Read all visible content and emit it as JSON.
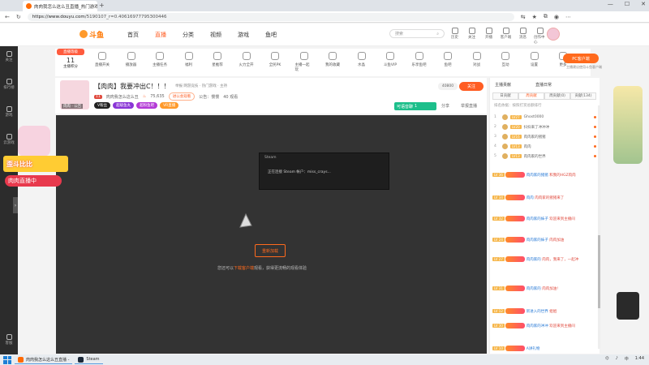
{
  "browser": {
    "tab_title": "肉肉我怎么这么丑直播_热门游戏直",
    "url_domain": "https://www.douyu.com",
    "url_path": "/5190107_r=0.40616977795300446"
  },
  "site": {
    "logo": "斗鱼",
    "nav": [
      "首页",
      "直播",
      "分类",
      "视频",
      "游戏",
      "鱼吧"
    ],
    "search_placeholder": "搜索",
    "header_icons": [
      "历史",
      "关注",
      "开播",
      "客户端",
      "消息",
      "创作中心"
    ],
    "badge_msg": "2",
    "badge_avatar": "30"
  },
  "leftbar": [
    "关注",
    "排行榜",
    "游戏",
    "云游戏",
    "客服"
  ],
  "toolbar": {
    "level_tag": "直播等级",
    "level_num": "11",
    "level_label": "主播积分",
    "items": [
      "直播开关",
      "播放器",
      "主播任务",
      "福利",
      "星推荐",
      "火力全开",
      "全民PK",
      "主播一起玩",
      "我的收藏",
      "水晶",
      "斗鱼VIP",
      "乐享鱼吧",
      "鱼吧",
      "对战",
      "互动",
      "设置",
      "更多"
    ],
    "pc_button": "PC客户端",
    "pc_note": "主播建议使用斗鱼客户端"
  },
  "stream": {
    "title": "【肉肉】我要冲出C！！！",
    "meta": "举报  网游竞技 · 热门游戏 · 主持",
    "level": "11",
    "streamer": "肉肉我怎么这么丑",
    "heat": "75,635",
    "guild": "进公会观看",
    "notice": "公告：慢慢",
    "viewers": "40 观看",
    "avatar_label": "肉肉 · 公告",
    "tags": [
      "V粉丝",
      "超级鱼丸",
      "超粉鱼吧",
      "VR直播"
    ],
    "hot_count": "40800",
    "subscribe": "关注",
    "voice": "可语音聊",
    "voice_count": "1",
    "share": "分享",
    "report": "举报直播"
  },
  "player": {
    "steam_header": "Steam",
    "steam_text": "正在连接 Steam 帐户：miss_crays...",
    "retry": "重新加载",
    "download_prefix": "您还可以",
    "download_link": "下载客户端",
    "download_suffix": "观看，获得更流畅的观看体验"
  },
  "float": {
    "banner": "歪斗比比",
    "sub": "肉肉直播中"
  },
  "chat": {
    "header_left": "主播贡献",
    "header_right": "直播日常",
    "tabs": [
      "日贡献",
      "周贡献",
      "周贡献(0)",
      "贡献(134)"
    ],
    "rank_note": "排名依据：按照打赏总额排行",
    "ranks": [
      {
        "n": "1",
        "lv": "LV27",
        "name": "Ghost0000"
      },
      {
        "n": "2",
        "lv": "LV20",
        "name": "抖抖来了冲冲冲"
      },
      {
        "n": "3",
        "lv": "LV16",
        "name": "肉肉家的猪猪"
      },
      {
        "n": "4",
        "lv": "LV13",
        "name": "肉肉"
      },
      {
        "n": "5",
        "lv": "LV13",
        "name": "肉肉家的世界"
      }
    ],
    "messages": [
      {
        "lv": "LV 36",
        "name": "肉肉家的猪猪",
        "text": "和我的HGZ肉肉"
      },
      {
        "lv": "LV 34",
        "name": "肉肉",
        "text": "肉肉家的猪猪来了"
      },
      {
        "lv": "LV 32",
        "name": "肉肉家的妹子",
        "text": "欢迎来到主播间"
      },
      {
        "lv": "LV 24",
        "name": "肉肉家的妹子",
        "text": "肉肉加油"
      },
      {
        "lv": "LV 27",
        "name": "肉肉家的",
        "text": "肉肉，我来了，一起冲"
      },
      {
        "lv": "LV 31",
        "name": "肉肉家的",
        "text": "肉肉加油!"
      },
      {
        "lv": "LV 12",
        "name": "新进入的世界",
        "text": "姐姐"
      },
      {
        "lv": "LV 30",
        "name": "肉肉家的冲冲",
        "text": "欢迎来到主播间"
      },
      {
        "lv": "LV 10",
        "name": "A讲礼物",
        "text": ""
      }
    ]
  },
  "taskbar": {
    "tasks": [
      "肉肉我怎么这么丑直播 -",
      "Steam"
    ],
    "time": "1:44",
    "lang": "中"
  }
}
